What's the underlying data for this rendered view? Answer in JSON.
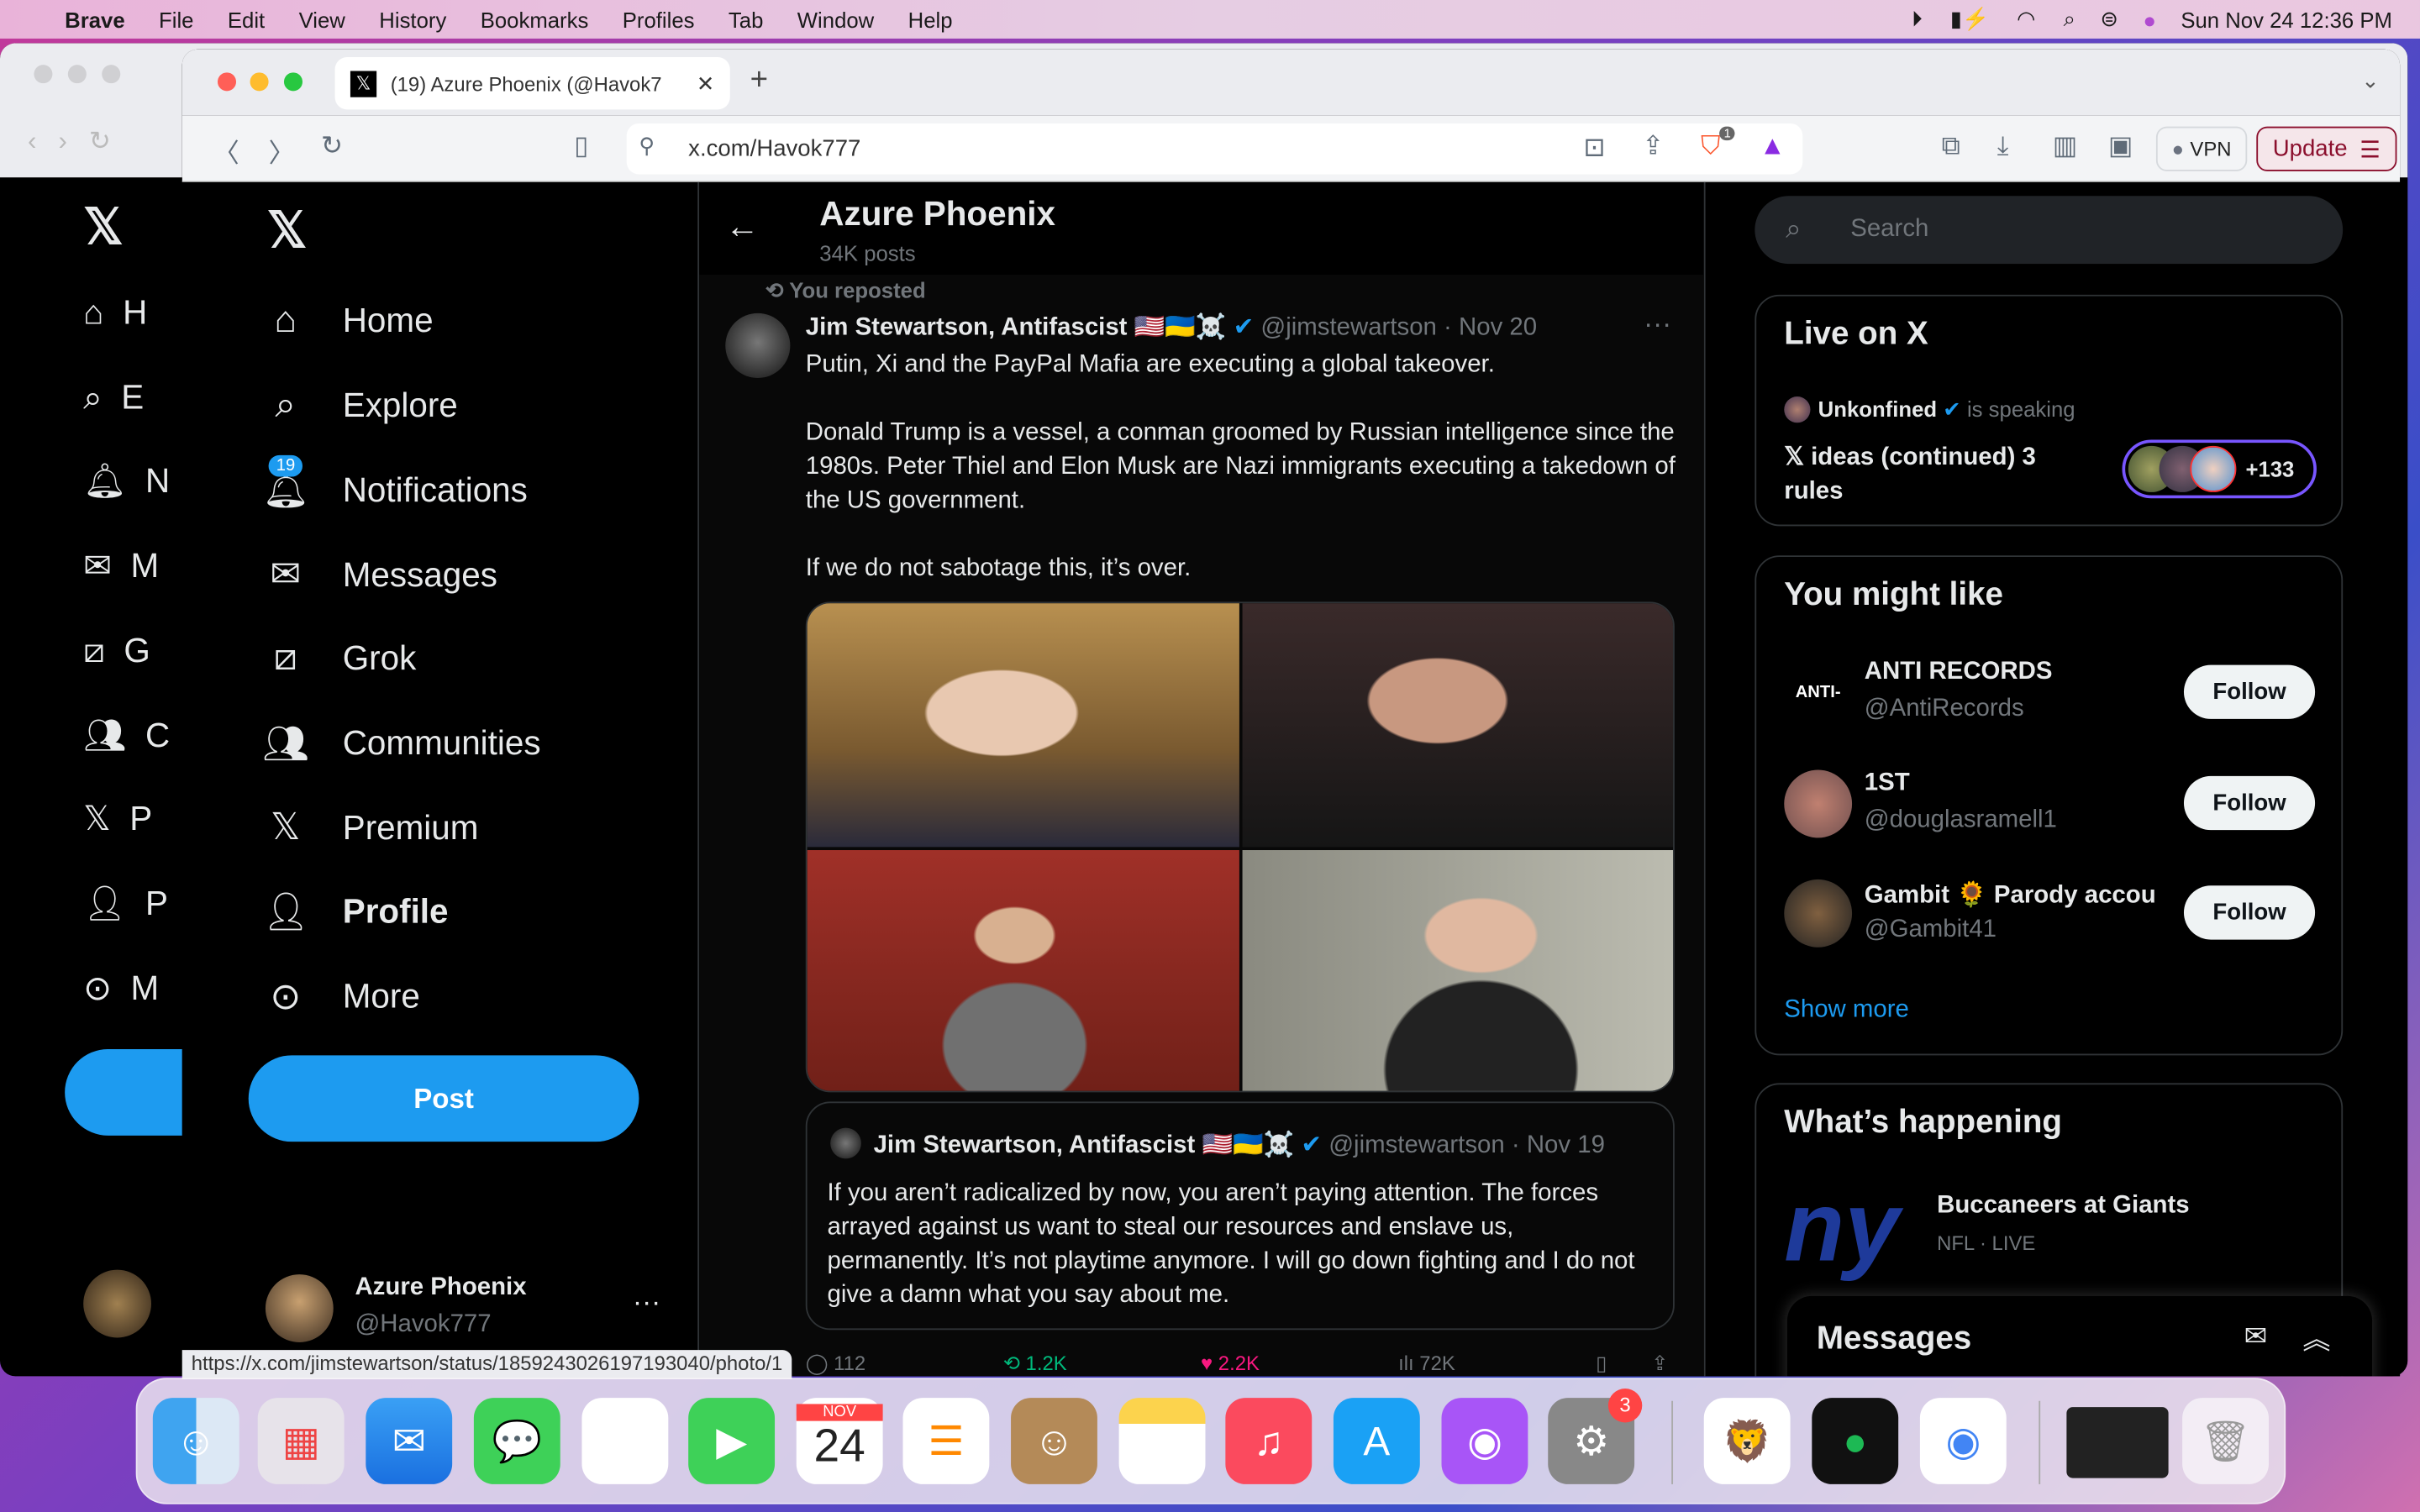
{
  "menubar": {
    "app": "Brave",
    "items": [
      "File",
      "Edit",
      "View",
      "History",
      "Bookmarks",
      "Profiles",
      "Tab",
      "Window",
      "Help"
    ],
    "clock": "Sun Nov 24  12:36 PM"
  },
  "browser": {
    "tab_title": "(19) Azure Phoenix (@Havok7",
    "url": "x.com/Havok777",
    "shields_badge": "1",
    "vpn_label": "VPN",
    "update_label": "Update",
    "status_url": "https://x.com/jimstewartson/status/1859243026197193040/photo/1"
  },
  "sidebar": {
    "items": [
      {
        "label": "Home",
        "icon": "home-icon"
      },
      {
        "label": "Explore",
        "icon": "search-icon"
      },
      {
        "label": "Notifications",
        "icon": "bell-icon",
        "badge": "19"
      },
      {
        "label": "Messages",
        "icon": "mail-icon"
      },
      {
        "label": "Grok",
        "icon": "grok-icon"
      },
      {
        "label": "Communities",
        "icon": "communities-icon"
      },
      {
        "label": "Premium",
        "icon": "x-logo-icon"
      },
      {
        "label": "Profile",
        "icon": "person-icon"
      },
      {
        "label": "More",
        "icon": "more-circle-icon"
      }
    ],
    "post_label": "Post",
    "account": {
      "name": "Azure Phoenix",
      "handle": "@Havok777"
    },
    "bg_letters": [
      "H",
      "E",
      "N",
      "M",
      "G",
      "C",
      "P",
      "P",
      "M"
    ]
  },
  "profile_header": {
    "name": "Azure Phoenix",
    "posts": "34K posts"
  },
  "tweet": {
    "repost_label": "You reposted",
    "author": "Jim Stewartson, Antifascist",
    "flags": "🇺🇸🇺🇦☠️",
    "handle": "@jimstewartson",
    "date": "· Nov 20",
    "paragraphs": [
      "Putin, Xi and the PayPal Mafia are executing a global takeover.",
      "Donald Trump is a vessel, a conman groomed by Russian intelligence since the 1980s. Peter Thiel and Elon Musk are Nazi immigrants executing a takedown of the US government.",
      "If we do not sabotage this, it’s over."
    ],
    "quote": {
      "author": "Jim Stewartson, Antifascist",
      "flags": "🇺🇸🇺🇦☠️",
      "handle": "@jimstewartson",
      "date": "· Nov 19",
      "text": "If you aren’t radicalized by now, you aren’t paying attention. The forces arrayed against us want to steal our resources and enslave us, permanently. It’s not playtime anymore. I will go down fighting and I do not give a damn what you say about me."
    },
    "stats": {
      "replies": "112",
      "reposts": "1.2K",
      "likes": "2.2K",
      "views": "72K"
    }
  },
  "right": {
    "search_placeholder": "Search",
    "live": {
      "title": "Live on X",
      "host": "Unkonfined",
      "speaking": "is speaking",
      "space_title": "𝕏 ideas (continued) 3 rules",
      "listeners": "+133"
    },
    "might_like": {
      "title": "You might like",
      "users": [
        {
          "name": "ANTI RECORDS",
          "handle": "@AntiRecords",
          "logo_text": "ANTI-"
        },
        {
          "name": "1ST",
          "handle": "@douglasramell1"
        },
        {
          "name": "Gambit 🌻 Parody accou",
          "handle": "@Gambit41"
        }
      ],
      "follow_label": "Follow",
      "show_more": "Show more"
    },
    "happening": {
      "title": "What’s happening",
      "event": "Buccaneers at Giants",
      "meta": "NFL · LIVE",
      "logo_text": "ny"
    },
    "messages_title": "Messages"
  },
  "dock": {
    "calendar_month": "NOV",
    "calendar_day": "24",
    "settings_badge": "3"
  },
  "colors": {
    "accent": "#1d9bf0",
    "like": "#f91880",
    "repost": "#00ba7c"
  }
}
